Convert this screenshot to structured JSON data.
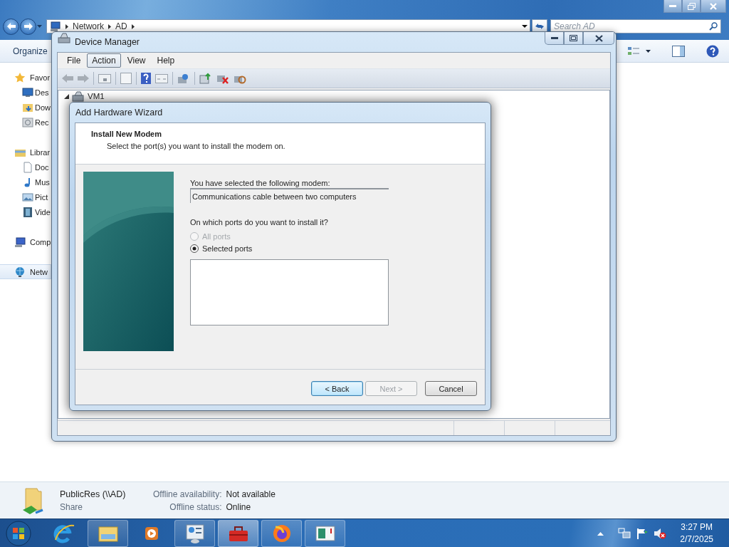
{
  "explorer": {
    "address": {
      "crumbs": [
        "Network",
        "AD"
      ]
    },
    "search": {
      "placeholder": "Search AD"
    },
    "toolbar": {
      "organize": "Organize"
    },
    "nav": [
      {
        "label": "Favor",
        "kind": "star",
        "selected": false,
        "children": [
          {
            "label": "Des",
            "kind": "desktop",
            "selected": false
          },
          {
            "label": "Dow",
            "kind": "download",
            "selected": false
          },
          {
            "label": "Rec",
            "kind": "recent",
            "selected": false
          }
        ]
      },
      {
        "label": "Librar",
        "kind": "library",
        "selected": false,
        "children": [
          {
            "label": "Doc",
            "kind": "document",
            "selected": false
          },
          {
            "label": "Mus",
            "kind": "music",
            "selected": false
          },
          {
            "label": "Pict",
            "kind": "picture",
            "selected": false
          },
          {
            "label": "Vide",
            "kind": "video",
            "selected": false
          }
        ]
      },
      {
        "label": "Comp",
        "kind": "computer",
        "selected": false
      },
      {
        "label": "Netw",
        "kind": "network",
        "selected": true
      }
    ],
    "details": {
      "name": "PublicRes (\\\\AD)",
      "type": "Share",
      "fields": [
        {
          "label": "Offline availability:",
          "value": "Not available"
        },
        {
          "label": "Offline status:",
          "value": "Online"
        }
      ]
    }
  },
  "device_manager": {
    "title": "Device Manager",
    "menu": [
      {
        "label": "File",
        "selected": false
      },
      {
        "label": "Action",
        "selected": true
      },
      {
        "label": "View",
        "selected": false
      },
      {
        "label": "Help",
        "selected": false
      }
    ],
    "tree": [
      {
        "label": "VM1",
        "expanded": true
      }
    ]
  },
  "wizard": {
    "title": "Add Hardware Wizard",
    "heading": "Install New Modem",
    "subtitle": "Select the port(s) you want to install the modem on.",
    "modem_label": "You have selected the following modem:",
    "modem_value": "Communications cable between two computers",
    "ports_label": "On which ports do you want to install it?",
    "port_options": [
      {
        "label": "All ports",
        "selected": false,
        "disabled": true
      },
      {
        "label": "Selected ports",
        "selected": true,
        "disabled": false
      }
    ],
    "buttons": [
      {
        "label": "< Back",
        "disabled": false,
        "focused": true
      },
      {
        "label": "Next >",
        "disabled": true,
        "focused": false
      },
      {
        "label": "Cancel",
        "disabled": false,
        "focused": false
      }
    ]
  },
  "taskbar": {
    "apps": [
      {
        "kind": "ie",
        "running": false,
        "active": false
      },
      {
        "kind": "explorer",
        "running": true,
        "active": false
      },
      {
        "kind": "media",
        "running": false,
        "active": false
      },
      {
        "kind": "control",
        "running": true,
        "active": false
      },
      {
        "kind": "toolbox",
        "running": true,
        "active": true
      },
      {
        "kind": "firefox",
        "running": true,
        "active": false
      },
      {
        "kind": "panel",
        "running": true,
        "active": false
      }
    ],
    "clock": {
      "time": "3:27 PM",
      "date": "2/7/2025"
    }
  }
}
